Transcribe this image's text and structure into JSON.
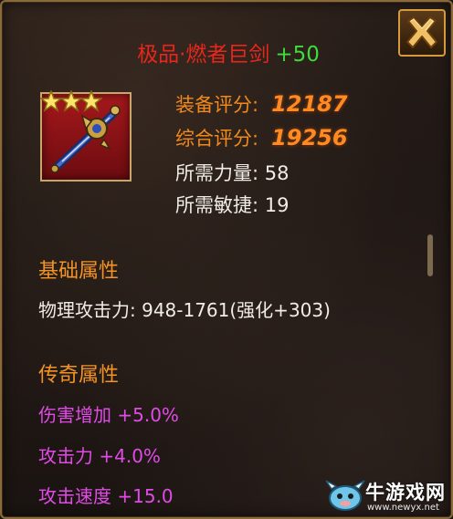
{
  "window": {
    "title_name": "极品·燃者巨剑",
    "title_bonus": "+50",
    "close_icon": "close-x-icon"
  },
  "item": {
    "stars": 3,
    "icon": "greatsword-icon",
    "colors": {
      "frame": "#c8a66a",
      "background": "#a5181c"
    }
  },
  "stats": {
    "equip_score_label": "装备评分:",
    "equip_score_value": "12187",
    "total_score_label": "综合评分:",
    "total_score_value": "19256",
    "req_strength_label": "所需力量:",
    "req_strength_value": "58",
    "req_agility_label": "所需敏捷:",
    "req_agility_value": "19"
  },
  "basic": {
    "title": "基础属性",
    "physical_attack": "物理攻击力: 948-1761(强化+303)"
  },
  "legendary": {
    "title": "传奇属性",
    "attrs": [
      "伤害增加 +5.0%",
      "攻击力 +4.0%",
      "攻击速度 +15.0"
    ]
  },
  "watermark": {
    "text": "牛游戏网",
    "url": "www.newyx.net"
  },
  "colors": {
    "title_red": "#e8261b",
    "bonus_green": "#3ddc3a",
    "section_orange": "#f39325",
    "legendary_purple": "#e04be6"
  }
}
